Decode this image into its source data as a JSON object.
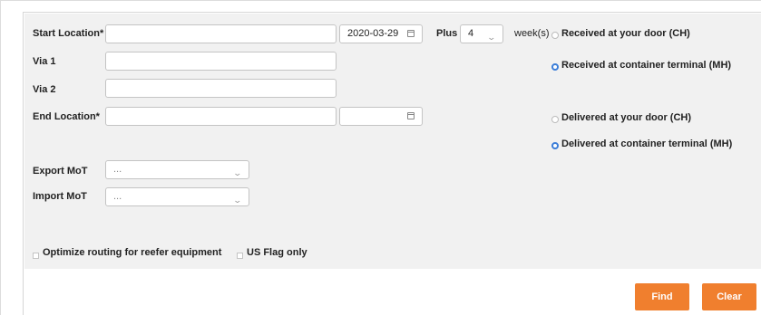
{
  "form": {
    "start_location_label": "Start Location*",
    "start_location_value": "",
    "start_date": "2020-03-29",
    "plus_label": "Plus",
    "plus_value": "4",
    "weeks_label": "week(s)",
    "via1_label": "Via 1",
    "via1_value": "",
    "via2_label": "Via 2",
    "via2_value": "",
    "end_location_label": "End Location*",
    "end_location_value": "",
    "end_date": "",
    "export_mot_label": "Export MoT",
    "export_mot_value": "...",
    "import_mot_label": "Import MoT",
    "import_mot_value": "...",
    "reefer_label": "Optimize routing for reefer equipment",
    "us_flag_label": "US Flag only"
  },
  "origin_options": [
    {
      "label": "Received at your door (CH)",
      "selected": false
    },
    {
      "label": "Received at container terminal (MH)",
      "selected": true
    }
  ],
  "destination_options": [
    {
      "label": "Delivered at your door (CH)",
      "selected": false
    },
    {
      "label": "Delivered at container terminal (MH)",
      "selected": true
    }
  ],
  "buttons": {
    "find_label": "Find",
    "clear_label": "Clear"
  },
  "colors": {
    "accent": "#f07f2e",
    "radio_selected": "#3b7dd8",
    "panel_bg": "#f1f1f1"
  },
  "icons": {
    "calendar": "calendar-icon",
    "dropdown": "chevron-down-icon"
  }
}
